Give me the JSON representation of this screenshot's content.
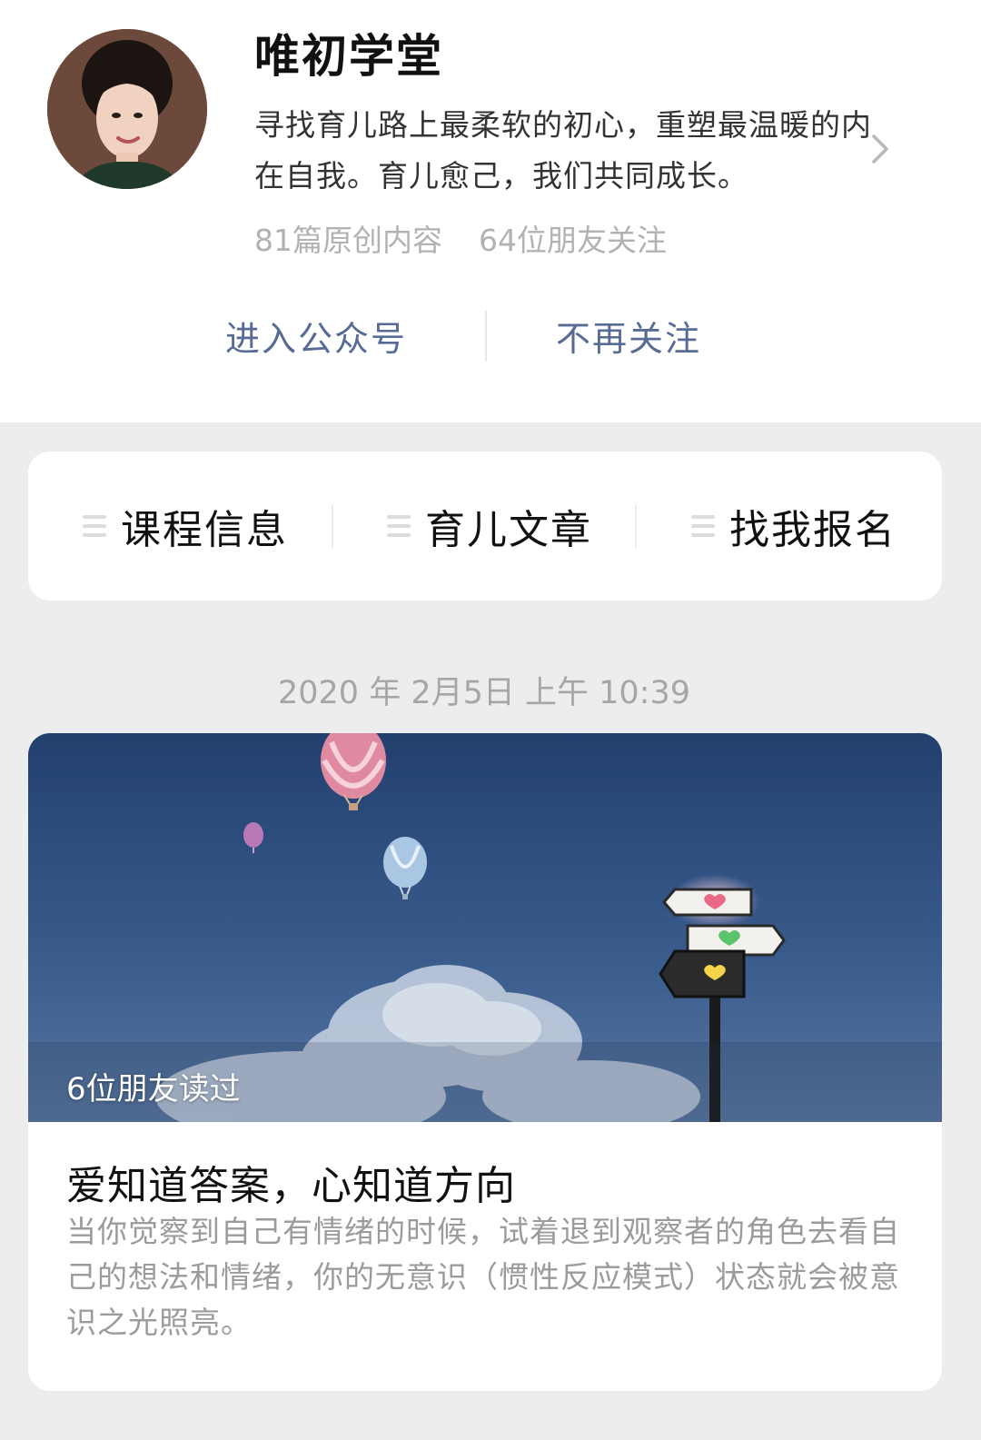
{
  "account": {
    "name": "唯初学堂",
    "description": "寻找育儿路上最柔软的初心，重塑最温暖的内在自我。育儿愈己，我们共同成长。",
    "stats": {
      "original": "81篇原创内容",
      "friends": "64位朋友关注"
    }
  },
  "actions": {
    "enter": "进入公众号",
    "unfollow": "不再关注"
  },
  "menu": {
    "items": [
      {
        "label": "课程信息",
        "icon": "menu-lines-icon"
      },
      {
        "label": "育儿文章",
        "icon": "menu-lines-icon"
      },
      {
        "label": "找我报名",
        "icon": "menu-lines-icon"
      }
    ]
  },
  "feed": {
    "timestamp": "2020 年 2月5日 上午 10:39",
    "article": {
      "readers": "6位朋友读过",
      "title": "爱知道答案，心知道方向",
      "digest": "当你觉察到自己有情绪的时候，试着退到观察者的角色去看自己的想法和情绪，你的无意识（惯性反应模式）状态就会被意识之光照亮。"
    }
  },
  "colors": {
    "link": "#576b95",
    "page_bg": "#ededed",
    "secondary_text": "#b2b2b2"
  }
}
